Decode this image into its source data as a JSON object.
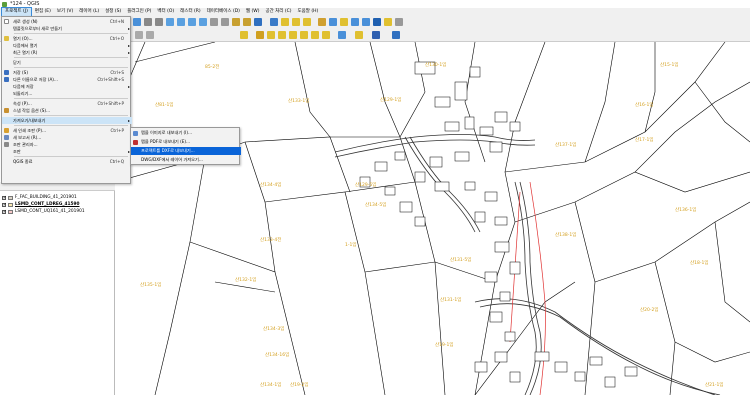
{
  "window": {
    "title": "*124 - QGIS"
  },
  "menubar": {
    "items": [
      "프로젝트 (J)",
      "편집 (E)",
      "보기 (V)",
      "레이어 (L)",
      "설정 (S)",
      "플러그인 (P)",
      "벡터 (O)",
      "래스터 (R)",
      "데이터베이스 (D)",
      "웹 (W)",
      "공간 처리 (C)",
      "도움말 (H)"
    ]
  },
  "project_menu": {
    "items": [
      {
        "label": "새로 생성 (N)",
        "shortcut": "Ctrl+N"
      },
      {
        "label": "템플릿으로부터 새로 만들기",
        "shortcut": ""
      },
      {
        "label": "열기 (O)...",
        "shortcut": "Ctrl+O"
      },
      {
        "label": "다음에서 열기",
        "shortcut": ""
      },
      {
        "label": "최근 열기 (R)",
        "shortcut": ""
      },
      {
        "label": "닫기",
        "shortcut": ""
      },
      {
        "label": "저장 (S)",
        "shortcut": "Ctrl+S"
      },
      {
        "label": "다른 이름으로 저장 (A)...",
        "shortcut": "Ctrl+Shift+S"
      },
      {
        "label": "다음에 저장",
        "shortcut": ""
      },
      {
        "label": "되돌리기...",
        "shortcut": ""
      },
      {
        "label": "속성 (P)...",
        "shortcut": "Ctrl+Shift+P"
      },
      {
        "label": "스냅 작업 옵션 (S)...",
        "shortcut": ""
      },
      {
        "label": "가져오기/내보내기",
        "shortcut": ""
      },
      {
        "label": "새 인쇄 조판 (P)...",
        "shortcut": "Ctrl+P"
      },
      {
        "label": "새 보고서 (R)...",
        "shortcut": ""
      },
      {
        "label": "조판 관리자...",
        "shortcut": ""
      },
      {
        "label": "조판",
        "shortcut": ""
      },
      {
        "label": "QGIS 종료",
        "shortcut": "Ctrl+Q"
      }
    ]
  },
  "export_submenu": {
    "items": [
      "맵을 이미지로 내보내기 (I)...",
      "맵을 PDF로 내보내기 (E)...",
      "프로젝트를 DXF로 내보내기...",
      "DWG/DXF에서 레이어 가져오기..."
    ]
  },
  "layers": [
    {
      "name": "F_FAC_BUILDING_41_201901",
      "color": "#dcd6c8"
    },
    {
      "name": "LSMD_CONT_LDREG_41590",
      "color": "#fbe9b0"
    },
    {
      "name": "LSMD_CONT_UQ161_41_201901",
      "color": "#f6c8c8"
    }
  ],
  "parcel_labels": [
    "85-2전",
    "산81-1임",
    "산135-1임",
    "산134-3임",
    "산134-4임",
    "산134-16임",
    "산134-1임",
    "산133-1임",
    "산133-4전",
    "산129-1임",
    "산129-5임",
    "산131-1임",
    "산132-1임",
    "1-1임",
    "산19-2임",
    "산19-1임",
    "산18-1임",
    "산20-2임",
    "산21-1임",
    "산130-1임",
    "산131-5임",
    "산17-1임",
    "산15-1임",
    "산16-1임",
    "산134-5임",
    "산137-1임",
    "산136-1임",
    "산138-1임"
  ],
  "colors": {
    "menu_bg": "#f2f2f2",
    "selection": "#cce4f7",
    "submenu_selection": "#0a64d8",
    "parcel_line": "#000000",
    "label": "#d4a020",
    "boundary_red": "#e03030"
  }
}
